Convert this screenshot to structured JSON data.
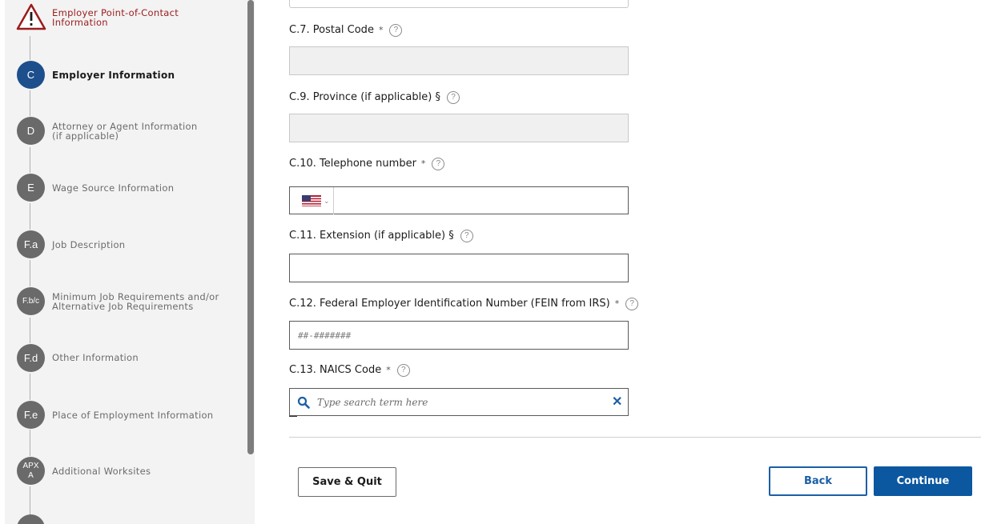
{
  "sidebar": {
    "steps": [
      {
        "badge": "",
        "label": "Employer Point-of-Contact\nInformation",
        "state": "warning"
      },
      {
        "badge": "C",
        "label": "Employer Information",
        "state": "active"
      },
      {
        "badge": "D",
        "label": "Attorney or Agent Information\n(if applicable)",
        "state": "default"
      },
      {
        "badge": "E",
        "label": "Wage Source Information",
        "state": "default"
      },
      {
        "badge": "F.a",
        "label": "Job Description",
        "state": "default"
      },
      {
        "badge": "F.b/c",
        "label": "Minimum Job Requirements and/or\nAlternative Job Requirements",
        "state": "default"
      },
      {
        "badge": "F.d",
        "label": "Other Information",
        "state": "default"
      },
      {
        "badge": "F.e",
        "label": "Place of Employment Information",
        "state": "default"
      },
      {
        "badge": "APX\nA",
        "label": "Additional Worksites",
        "state": "default"
      }
    ]
  },
  "form": {
    "postal_code": {
      "label": "C.7. Postal Code",
      "required_mark": "*",
      "value": ""
    },
    "province": {
      "label": "C.9. Province (if applicable) §",
      "value": ""
    },
    "telephone": {
      "label": "C.10. Telephone number",
      "required_mark": "*",
      "country_icon": "us-flag-icon",
      "value": ""
    },
    "extension": {
      "label": "C.11. Extension (if applicable) §",
      "value": ""
    },
    "fein": {
      "label": "C.12. Federal Employer Identification Number (FEIN from IRS)",
      "required_mark": "*",
      "placeholder": "##-#######",
      "value": ""
    },
    "naics": {
      "label": "C.13. NAICS Code",
      "required_mark": "*",
      "placeholder": "Type search term here",
      "value": ""
    },
    "help_glyph": "?"
  },
  "buttons": {
    "save_quit": "Save & Quit",
    "back": "Back",
    "continue": "Continue"
  },
  "colors": {
    "active_step": "#1c4f8c",
    "inactive_step": "#6a6a6a",
    "warning": "#9b1c1c",
    "primary": "#0b57a0"
  }
}
